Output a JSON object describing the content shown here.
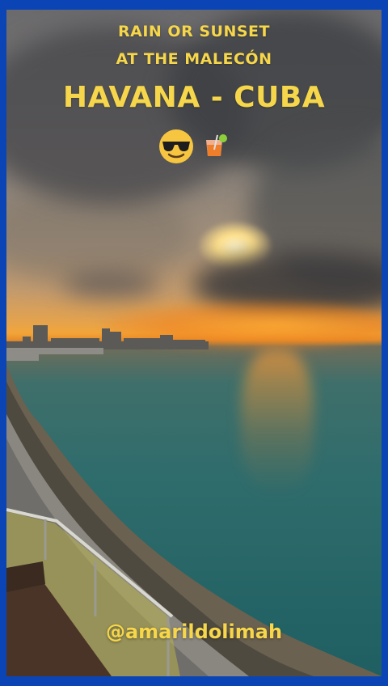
{
  "caption": {
    "line1": "RAIN OR SUNSET",
    "line2": "AT THE MALECÓN",
    "line3": "HAVANA - CUBA"
  },
  "emojis": [
    "sunglasses-face-icon",
    "cocktail-drink-icon"
  ],
  "handle": "@amarildolimah",
  "colors": {
    "frame": "#0b45b5",
    "caption": "#f6d64a"
  }
}
